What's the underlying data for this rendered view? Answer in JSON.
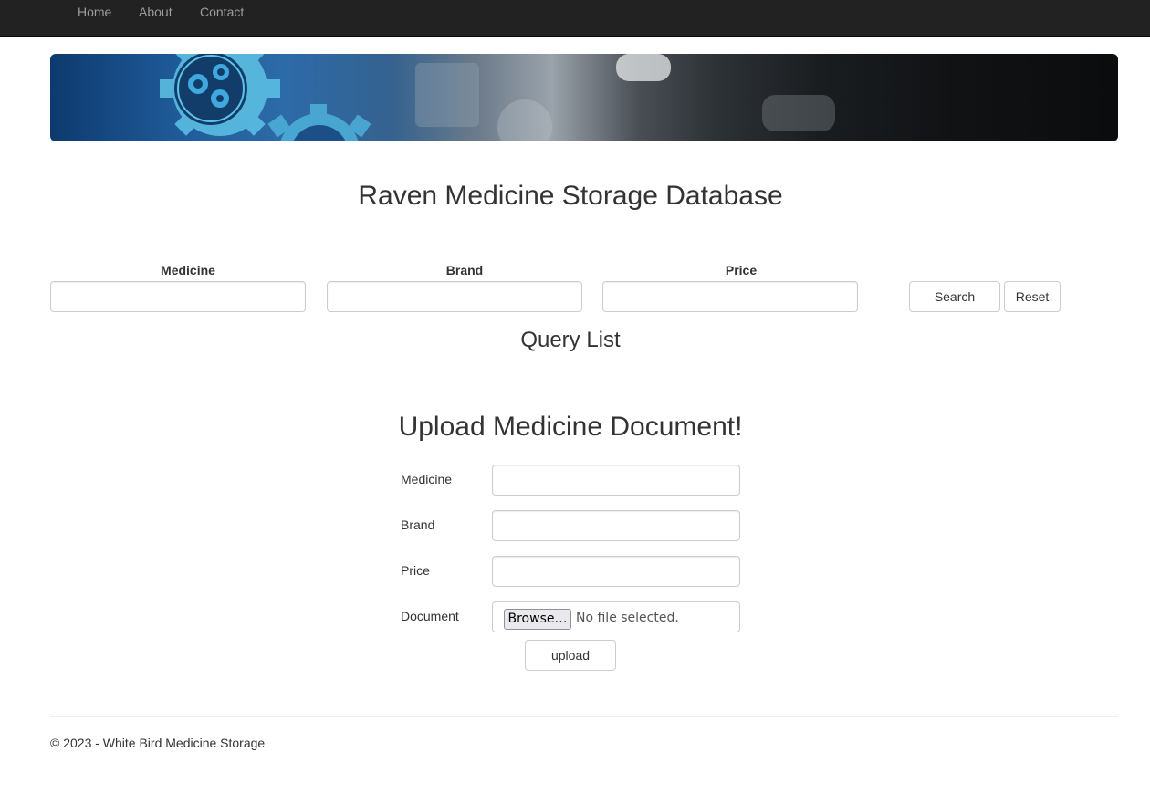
{
  "nav": {
    "items": [
      {
        "label": "Home"
      },
      {
        "label": "About"
      },
      {
        "label": "Contact"
      }
    ]
  },
  "page": {
    "title": "Raven Medicine Storage Database"
  },
  "search": {
    "medicine_label": "Medicine",
    "brand_label": "Brand",
    "price_label": "Price",
    "medicine_value": "",
    "brand_value": "",
    "price_value": "",
    "search_button": "Search",
    "reset_button": "Reset"
  },
  "query": {
    "heading": "Query List"
  },
  "upload": {
    "heading": "Upload Medicine Document!",
    "medicine_label": "Medicine",
    "brand_label": "Brand",
    "price_label": "Price",
    "document_label": "Document",
    "browse_button": "Browse…",
    "file_status": "No file selected.",
    "upload_button": "upload"
  },
  "footer": {
    "text": "© 2023 - White Bird Medicine Storage"
  },
  "colors": {
    "navbar": "#222222",
    "nav_link": "#9d9d9d",
    "text": "#333333",
    "border": "#cccccc"
  }
}
